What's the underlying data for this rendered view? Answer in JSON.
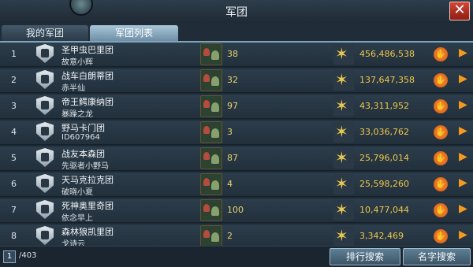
{
  "window": {
    "title": "军团",
    "close_glyph": "✕"
  },
  "tabs": [
    {
      "label": "我的军团",
      "active": false
    },
    {
      "label": "军团列表",
      "active": true
    }
  ],
  "rows": [
    {
      "rank": "1",
      "name": "圣甲虫巴里团",
      "leader": "故意小辉",
      "members": "38",
      "power": "456,486,538"
    },
    {
      "rank": "2",
      "name": "战车白朗蒂团",
      "leader": "赤半仙",
      "members": "32",
      "power": "137,647,358"
    },
    {
      "rank": "3",
      "name": "帝王鳄康纳团",
      "leader": "暴躁之龙",
      "members": "97",
      "power": "43,311,952"
    },
    {
      "rank": "4",
      "name": "野马卡门团",
      "leader": "ID607964",
      "members": "3",
      "power": "33,036,762"
    },
    {
      "rank": "5",
      "name": "战友本森团",
      "leader": "先驱者小野马",
      "members": "87",
      "power": "25,796,014"
    },
    {
      "rank": "6",
      "name": "天马克拉克团",
      "leader": "破晓小夏",
      "members": "4",
      "power": "25,598,260"
    },
    {
      "rank": "7",
      "name": "死神奥里奇团",
      "leader": "依念早上",
      "members": "100",
      "power": "10,477,044"
    },
    {
      "rank": "8",
      "name": "森林狼凯里团",
      "leader": "戈诗云",
      "members": "2",
      "power": "3,342,469"
    }
  ],
  "footer": {
    "current_page": "1",
    "total_pages": "/403",
    "rank_search_label": "排行搜索",
    "name_search_label": "名字搜索"
  },
  "icons": {
    "emblem": "legion-emblem-icon",
    "members": "soldiers-icon",
    "power": "star-badge-icon",
    "action": "apply-hand-icon",
    "arrow": "arrow-right-icon"
  },
  "colors": {
    "accent": "#f49a1e",
    "power_text": "#eec84c",
    "close": "#c0392b"
  }
}
